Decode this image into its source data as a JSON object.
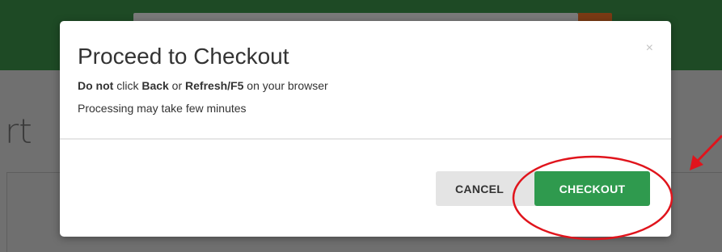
{
  "background": {
    "heading_fragment": "rt"
  },
  "modal": {
    "title": "Proceed to Checkout",
    "close_symbol": "×",
    "warning": {
      "part1": "Do not",
      "part2": " click ",
      "part3": "Back",
      "part4": " or ",
      "part5": "Refresh/F5",
      "part6": " on your browser"
    },
    "processing_note": "Processing may take few minutes",
    "buttons": {
      "cancel": "CANCEL",
      "checkout": "CHECKOUT"
    }
  },
  "colors": {
    "checkout_green": "#2f9a4e",
    "annotation_red": "#e0141c"
  },
  "icons": [
    "close-icon",
    "annotation-arrow-icon"
  ]
}
